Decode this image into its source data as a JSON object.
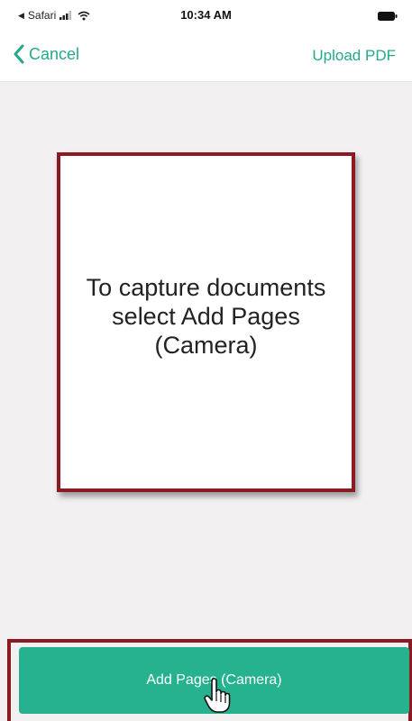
{
  "status_bar": {
    "back_app": "Safari",
    "time": "10:34 AM",
    "icons": [
      "signal-icon",
      "wifi-icon",
      "battery-icon"
    ]
  },
  "nav": {
    "cancel_label": "Cancel",
    "upload_label": "Upload PDF"
  },
  "placeholder": {
    "text": "To capture documents select Add Pages (Camera)"
  },
  "actions": {
    "add_pages_label": "Add Pages (Camera)"
  },
  "colors": {
    "accent": "#26b18f",
    "accent_text": "#25a98b",
    "highlight_border": "#8b1a22",
    "background": "#f2f0f1"
  }
}
